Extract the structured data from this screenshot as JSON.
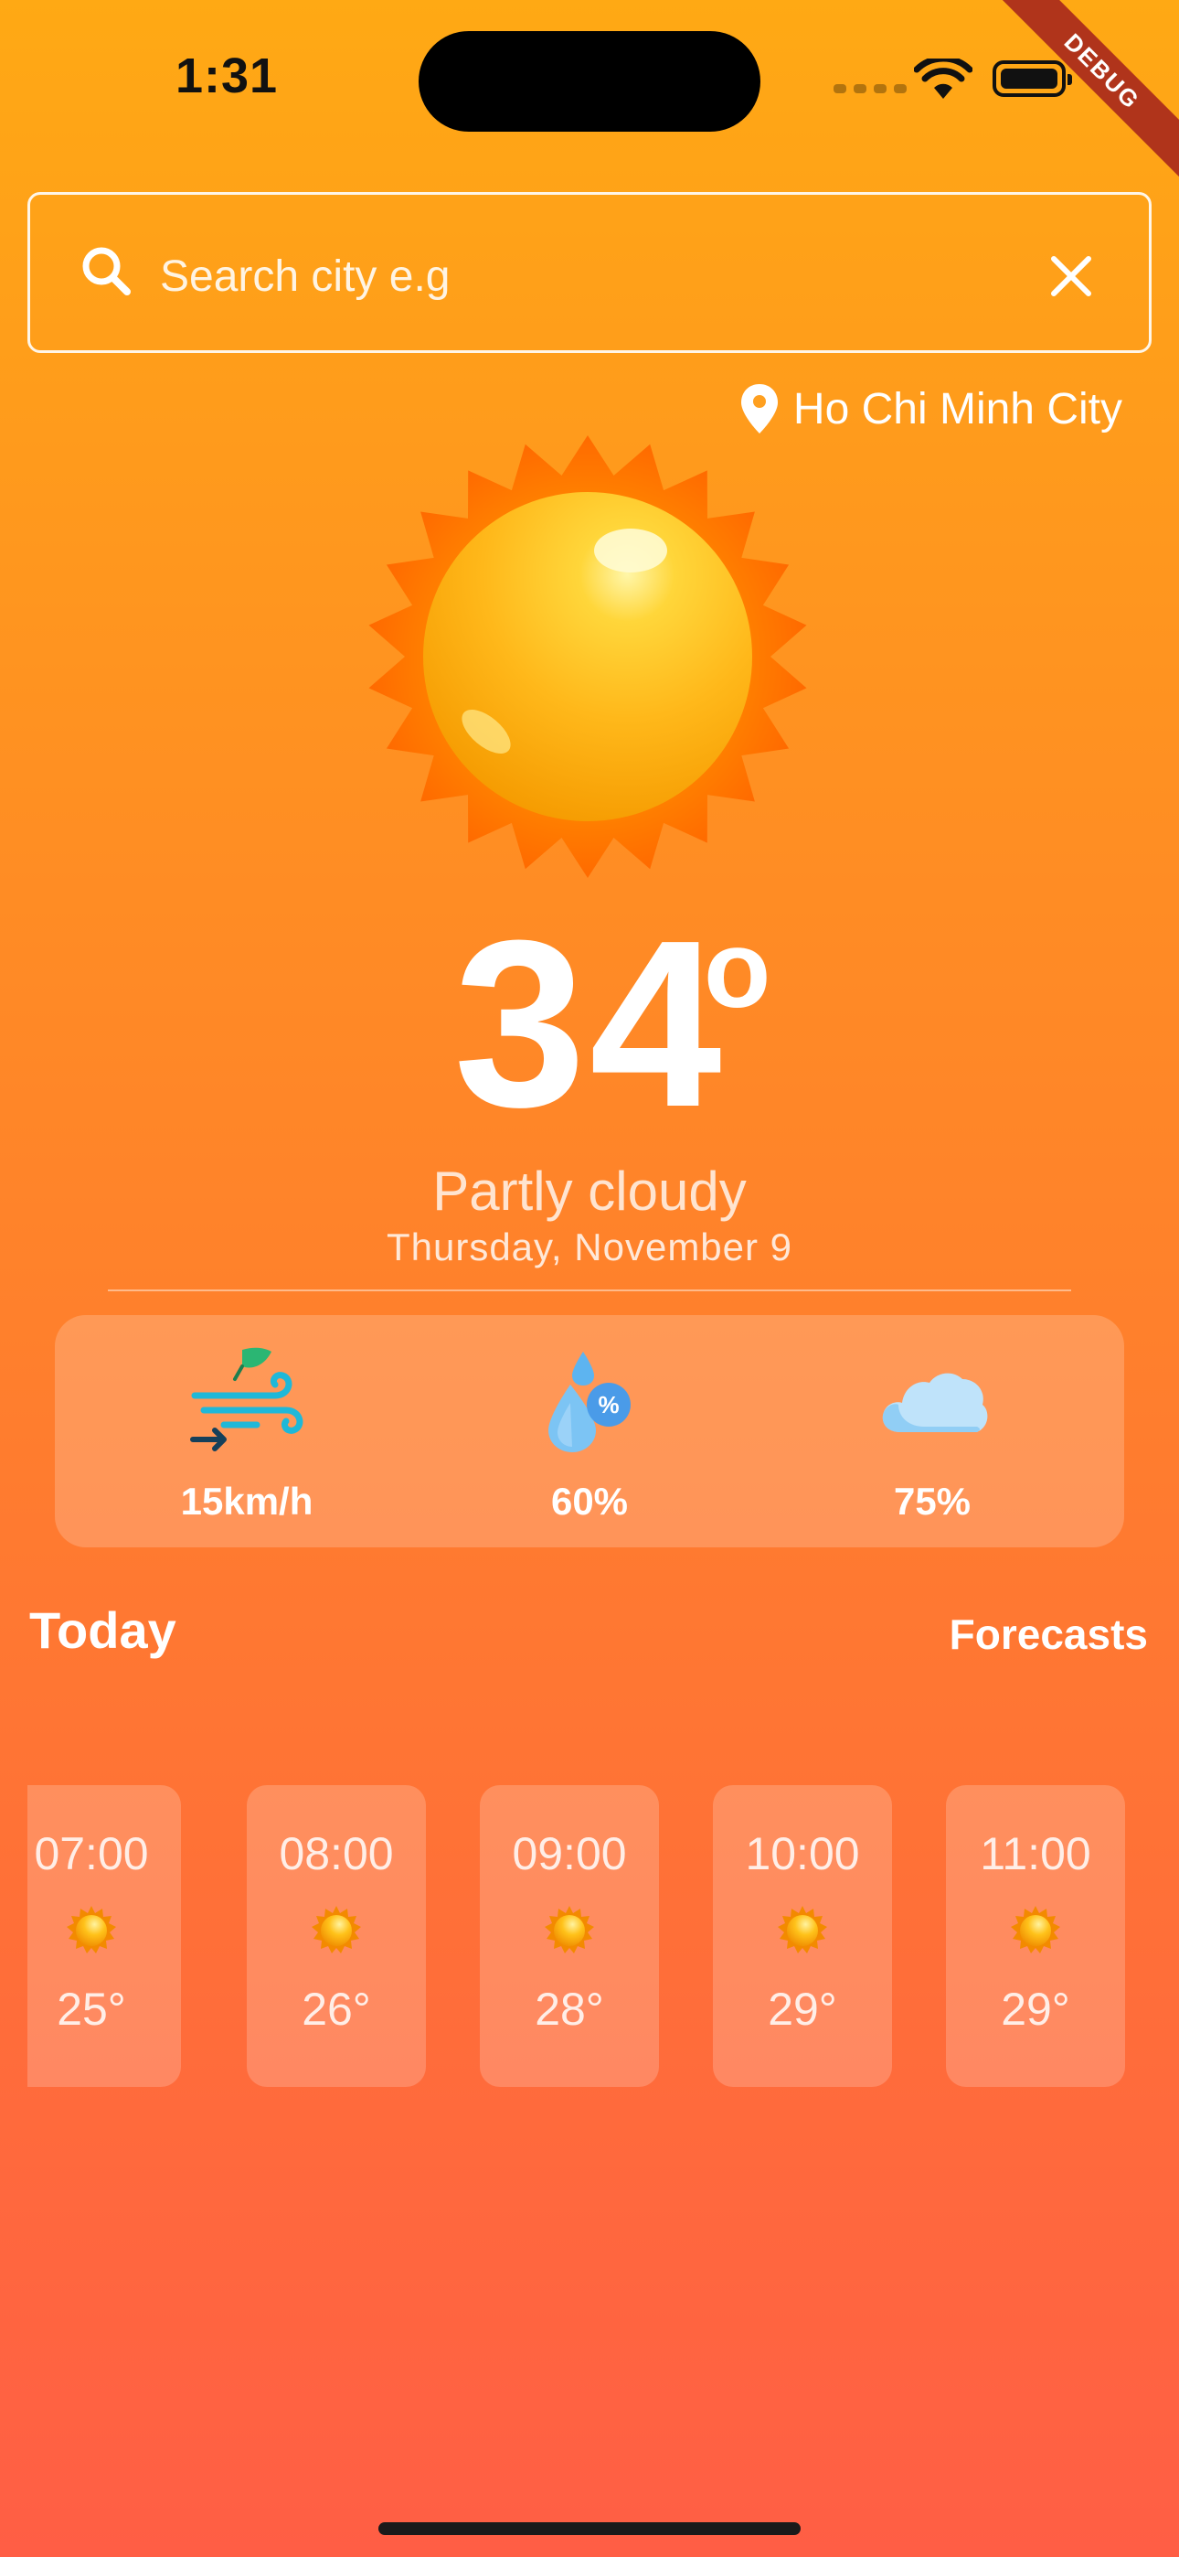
{
  "status_bar": {
    "time": "1:31"
  },
  "debug_banner": "DEBUG",
  "search": {
    "placeholder": "Search city e.g",
    "value": ""
  },
  "location": "Ho Chi Minh City",
  "weather": {
    "temperature": "34",
    "degree_symbol": "o",
    "condition": "Partly cloudy",
    "date": "Thursday, November 9"
  },
  "stats": {
    "wind": "15km/h",
    "humidity": "60%",
    "cloud": "75%"
  },
  "section": {
    "today": "Today",
    "forecasts": "Forecasts"
  },
  "hourly": [
    {
      "time": "07:00",
      "temp": "25°",
      "icon": "sun-icon"
    },
    {
      "time": "08:00",
      "temp": "26°",
      "icon": "sun-icon"
    },
    {
      "time": "09:00",
      "temp": "28°",
      "icon": "sun-icon"
    },
    {
      "time": "10:00",
      "temp": "29°",
      "icon": "sun-icon"
    },
    {
      "time": "11:00",
      "temp": "29°",
      "icon": "sun-icon"
    }
  ],
  "colors": {
    "background_top": "#FFA914",
    "background_bottom": "#FF5E45",
    "sun": "#FFB300",
    "sun_rays": "#FF7A00"
  }
}
